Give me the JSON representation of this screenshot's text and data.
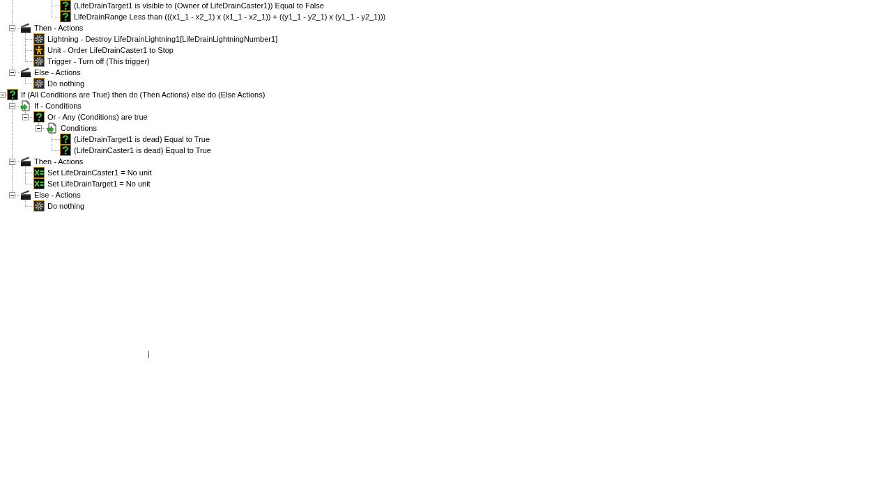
{
  "tree": {
    "items": [
      {
        "children": [
          {
            "children": [
              {
                "children": [
                  {
                    "children": [
                      {
                        "kind": "condition",
                        "label": "(LifeDrainTarget1 is visible to (Owner of LifeDrainCaster1)) Equal to False"
                      },
                      {
                        "kind": "condition",
                        "label": "LifeDrainRange Less than (((x1_1 - x2_1) x (x1_1 - x2_1)) + ((y1_1 - y2_1) x (y1_1 - y2_1)))"
                      }
                    ]
                  }
                ]
              }
            ]
          },
          {
            "kind": "actions",
            "label": "Then - Actions",
            "expanded": true,
            "children": [
              {
                "kind": "gear",
                "label": "Lightning - Destroy LifeDrainLightning1[LifeDrainLightningNumber1]"
              },
              {
                "kind": "unit",
                "label": "Unit - Order LifeDrainCaster1 to Stop"
              },
              {
                "kind": "gear",
                "label": "Trigger - Turn off (This trigger)"
              }
            ]
          },
          {
            "kind": "actions",
            "label": "Else - Actions",
            "expanded": true,
            "children": [
              {
                "kind": "gear",
                "label": "Do nothing"
              }
            ]
          }
        ]
      },
      {
        "kind": "condition",
        "label": "If (All Conditions are True) then do (Then Actions) else do (Else Actions)",
        "expanded": true,
        "children": [
          {
            "kind": "conditions",
            "label": "If - Conditions",
            "expanded": true,
            "children": [
              {
                "kind": "condition",
                "label": "Or - Any (Conditions) are true",
                "expanded": true,
                "children": [
                  {
                    "kind": "conditions",
                    "label": "Conditions",
                    "expanded": true,
                    "children": [
                      {
                        "kind": "condition",
                        "label": "(LifeDrainTarget1 is dead) Equal to True"
                      },
                      {
                        "kind": "condition",
                        "label": "(LifeDrainCaster1 is dead) Equal to True"
                      }
                    ]
                  }
                ]
              }
            ]
          },
          {
            "kind": "actions",
            "label": "Then - Actions",
            "expanded": true,
            "children": [
              {
                "kind": "set",
                "label": "Set LifeDrainCaster1 = No unit"
              },
              {
                "kind": "set",
                "label": "Set LifeDrainTarget1 = No unit"
              }
            ]
          },
          {
            "kind": "actions",
            "label": "Else - Actions",
            "expanded": true,
            "children": [
              {
                "kind": "gear",
                "label": "Do nothing"
              }
            ]
          }
        ]
      }
    ]
  }
}
